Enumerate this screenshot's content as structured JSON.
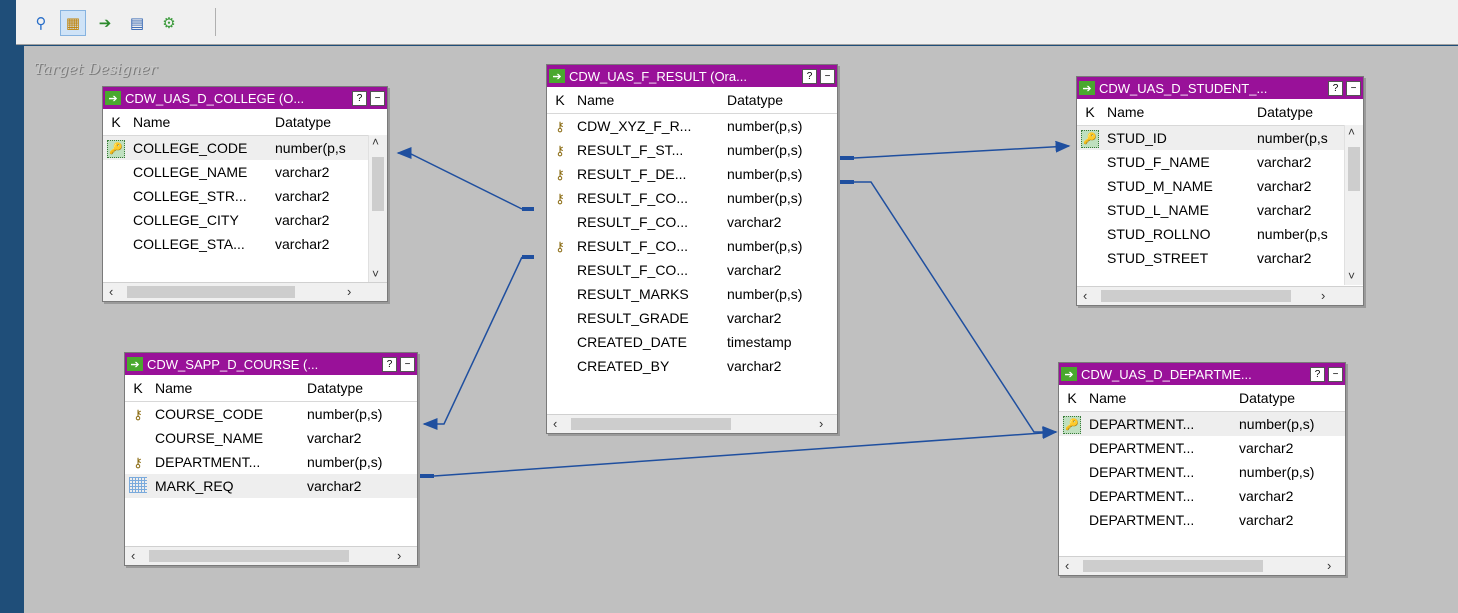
{
  "toolbar": {
    "buttons": [
      {
        "name": "zoom-icon",
        "glyph": "⚲"
      },
      {
        "name": "arrange-icon",
        "glyph": "▦"
      },
      {
        "name": "import-icon",
        "glyph": "➔"
      },
      {
        "name": "table-icon",
        "glyph": "▤"
      },
      {
        "name": "link-icon",
        "glyph": "⚙"
      }
    ]
  },
  "canvas": {
    "title": "Target Designer"
  },
  "headers": {
    "k": "K",
    "name": "Name",
    "datatype": "Datatype"
  },
  "title_buttons": {
    "help": "?",
    "minimize": "−"
  },
  "tables": {
    "college": {
      "title": "CDW_UAS_D_COLLEGE (O...",
      "rows": [
        {
          "name": "COLLEGE_CODE",
          "type": "number(p,s"
        },
        {
          "name": "COLLEGE_NAME",
          "type": "varchar2"
        },
        {
          "name": "COLLEGE_STR...",
          "type": "varchar2"
        },
        {
          "name": "COLLEGE_CITY",
          "type": "varchar2"
        },
        {
          "name": "COLLEGE_STA...",
          "type": "varchar2"
        }
      ]
    },
    "result": {
      "title": "CDW_UAS_F_RESULT (Ora...",
      "rows": [
        {
          "name": "CDW_XYZ_F_R...",
          "type": "number(p,s)"
        },
        {
          "name": "RESULT_F_ST...",
          "type": "number(p,s)"
        },
        {
          "name": "RESULT_F_DE...",
          "type": "number(p,s)"
        },
        {
          "name": "RESULT_F_CO...",
          "type": "number(p,s)"
        },
        {
          "name": "RESULT_F_CO...",
          "type": "varchar2"
        },
        {
          "name": "RESULT_F_CO...",
          "type": "number(p,s)"
        },
        {
          "name": "RESULT_F_CO...",
          "type": "varchar2"
        },
        {
          "name": "RESULT_MARKS",
          "type": "number(p,s)"
        },
        {
          "name": "RESULT_GRADE",
          "type": "varchar2"
        },
        {
          "name": "CREATED_DATE",
          "type": "timestamp"
        },
        {
          "name": "CREATED_BY",
          "type": "varchar2"
        }
      ]
    },
    "student": {
      "title": "CDW_UAS_D_STUDENT_...",
      "rows": [
        {
          "name": "STUD_ID",
          "type": "number(p,s"
        },
        {
          "name": "STUD_F_NAME",
          "type": "varchar2"
        },
        {
          "name": "STUD_M_NAME",
          "type": "varchar2"
        },
        {
          "name": "STUD_L_NAME",
          "type": "varchar2"
        },
        {
          "name": "STUD_ROLLNO",
          "type": "number(p,s"
        },
        {
          "name": "STUD_STREET",
          "type": "varchar2"
        }
      ]
    },
    "course": {
      "title": "CDW_SAPP_D_COURSE (...",
      "rows": [
        {
          "name": "COURSE_CODE",
          "type": "number(p,s)"
        },
        {
          "name": "COURSE_NAME",
          "type": "varchar2"
        },
        {
          "name": "DEPARTMENT...",
          "type": "number(p,s)"
        },
        {
          "name": "MARK_REQ",
          "type": "varchar2"
        }
      ]
    },
    "department": {
      "title": "CDW_UAS_D_DEPARTME...",
      "rows": [
        {
          "name": "DEPARTMENT...",
          "type": "number(p,s)"
        },
        {
          "name": "DEPARTMENT...",
          "type": "varchar2"
        },
        {
          "name": "DEPARTMENT...",
          "type": "number(p,s)"
        },
        {
          "name": "DEPARTMENT...",
          "type": "varchar2"
        },
        {
          "name": "DEPARTMENT...",
          "type": "varchar2"
        }
      ]
    }
  },
  "colors": {
    "title_bar": "#991199",
    "link": "#1f4f9f",
    "canvas": "#c0c0c0"
  }
}
